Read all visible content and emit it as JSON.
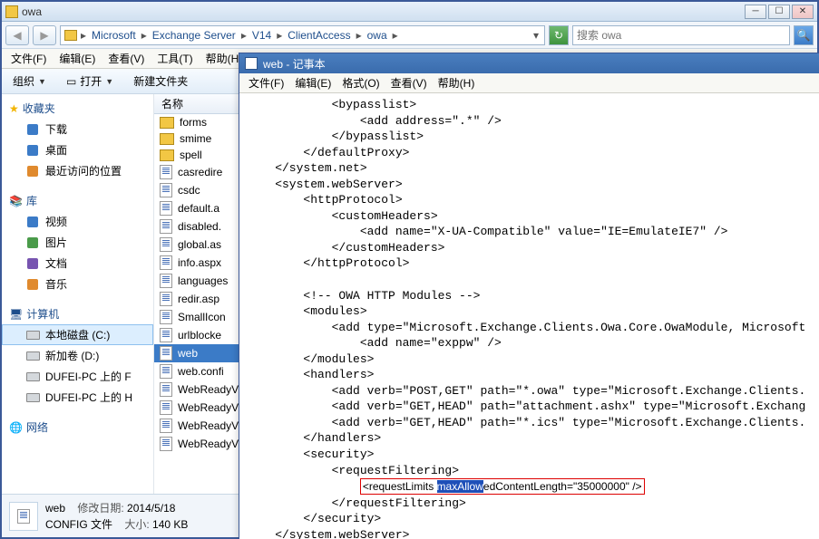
{
  "explorer": {
    "title": "owa",
    "path_segments": [
      "Microsoft",
      "Exchange Server",
      "V14",
      "ClientAccess",
      "owa"
    ],
    "search_placeholder": "搜索 owa",
    "menu": {
      "file": "文件(F)",
      "edit": "编辑(E)",
      "view": "查看(V)",
      "tools": "工具(T)",
      "help": "帮助(H)"
    },
    "orgbar": {
      "org": "组织",
      "open": "打开",
      "newfolder": "新建文件夹"
    },
    "nav": {
      "favorites": "收藏夹",
      "downloads": "下载",
      "desktop": "桌面",
      "recent": "最近访问的位置",
      "library": "库",
      "videos": "视频",
      "pictures": "图片",
      "documents": "文档",
      "music": "音乐",
      "computer": "计算机",
      "localdisk": "本地磁盘 (C:)",
      "newvol": "新加卷 (D:)",
      "dufei_f": "DUFEI-PC 上的 F",
      "dufei_h": "DUFEI-PC 上的 H",
      "network": "网络"
    },
    "list_header": "名称",
    "items": [
      {
        "t": "folder",
        "n": "forms"
      },
      {
        "t": "folder",
        "n": "smime"
      },
      {
        "t": "folder",
        "n": "spell"
      },
      {
        "t": "file",
        "n": "casredire"
      },
      {
        "t": "file",
        "n": "csdc"
      },
      {
        "t": "file",
        "n": "default.a"
      },
      {
        "t": "file",
        "n": "disabled."
      },
      {
        "t": "file",
        "n": "global.as"
      },
      {
        "t": "file",
        "n": "info.aspx"
      },
      {
        "t": "file",
        "n": "languages"
      },
      {
        "t": "file",
        "n": "redir.asp"
      },
      {
        "t": "file",
        "n": "SmallIcon"
      },
      {
        "t": "file",
        "n": "urlblocke"
      },
      {
        "t": "file",
        "n": "web",
        "sel": true
      },
      {
        "t": "file",
        "n": "web.confi"
      },
      {
        "t": "file",
        "n": "WebReadyV"
      },
      {
        "t": "file",
        "n": "WebReadyV"
      },
      {
        "t": "file",
        "n": "WebReadyV"
      },
      {
        "t": "file",
        "n": "WebReadyV"
      }
    ],
    "status": {
      "name": "web",
      "type": "CONFIG 文件",
      "date_k": "修改日期:",
      "date_v": "2014/5/18",
      "size_k": "大小:",
      "size_v": "140 KB"
    }
  },
  "notepad": {
    "title": "web - 记事本",
    "menu": {
      "file": "文件(F)",
      "edit": "编辑(E)",
      "format": "格式(O)",
      "view": "查看(V)",
      "help": "帮助(H)"
    },
    "lines": [
      "            <bypasslist>",
      "                <add address=\".*\" />",
      "            </bypasslist>",
      "        </defaultProxy>",
      "    </system.net>",
      "    <system.webServer>",
      "        <httpProtocol>",
      "            <customHeaders>",
      "                <add name=\"X-UA-Compatible\" value=\"IE=EmulateIE7\" />",
      "            </customHeaders>",
      "        </httpProtocol>",
      "",
      "        <!-- OWA HTTP Modules -->",
      "        <modules>",
      "            <add type=\"Microsoft.Exchange.Clients.Owa.Core.OwaModule, Microsoft",
      "                <add name=\"exppw\" />",
      "        </modules>",
      "        <handlers>",
      "            <add verb=\"POST,GET\" path=\"*.owa\" type=\"Microsoft.Exchange.Clients.",
      "            <add verb=\"GET,HEAD\" path=\"attachment.ashx\" type=\"Microsoft.Exchang",
      "            <add verb=\"GET,HEAD\" path=\"*.ics\" type=\"Microsoft.Exchange.Clients.",
      "        </handlers>",
      "        <security>",
      "            <requestFiltering>"
    ],
    "highlight_line_pre": "                ",
    "highlight_box_pre": "<requestLimits ",
    "highlight_sel": "maxAllow",
    "highlight_box_post": "edContentLength=\"35000000\" />",
    "lines_after": [
      "            </requestFiltering>",
      "        </security>",
      "    </system.webServer>"
    ]
  }
}
